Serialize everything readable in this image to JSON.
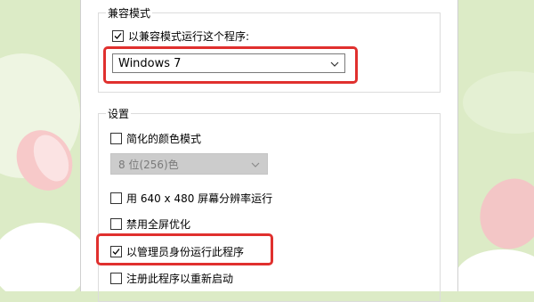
{
  "compat_group": {
    "title": "兼容模式",
    "run_compat_label": "以兼容模式运行这个程序:",
    "run_compat_checked": true,
    "os_select_value": "Windows 7"
  },
  "settings_group": {
    "title": "设置",
    "reduced_color_label": "简化的颜色模式",
    "reduced_color_checked": false,
    "color_depth_value": "8 位(256)色",
    "run_640_label": "用 640 x 480 屏幕分辨率运行",
    "disable_fullscreen_label": "禁用全屏优化",
    "run_admin_label": "以管理员身份运行此程序",
    "run_admin_checked": true,
    "register_restart_label": "注册此程序以重新启动"
  },
  "colors": {
    "highlight": "#e0302e",
    "background": "#dcebc6"
  }
}
